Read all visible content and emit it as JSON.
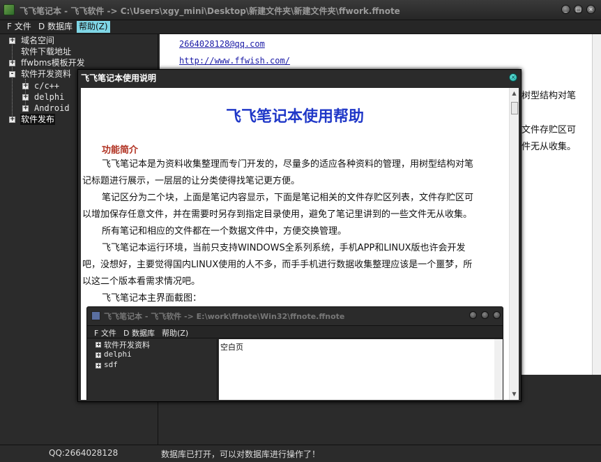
{
  "window": {
    "title": "飞飞笔记本 - 飞飞软件 -> C:\\Users\\xgy_mini\\Desktop\\新建文件夹\\新建文件夹\\ffwork.ffnote",
    "controls": [
      "_",
      "□",
      "×"
    ]
  },
  "menu": {
    "items": [
      "F 文件",
      "D 数据库",
      "帮助(Z)"
    ]
  },
  "tree": {
    "nodes": [
      {
        "label": "域名空间",
        "expander": "+"
      },
      {
        "label": "软件下载地址",
        "expander": ""
      },
      {
        "label": "ffwbms模板开发",
        "expander": "+"
      },
      {
        "label": "软件开发资料",
        "expander": "-"
      },
      {
        "label": "c/c++",
        "expander": "+"
      },
      {
        "label": "delphi",
        "expander": "+"
      },
      {
        "label": "Android",
        "expander": "+"
      },
      {
        "label": "软件发布",
        "expander": "+",
        "selected": true
      }
    ]
  },
  "background_note": {
    "email": "2664028128@qq.com",
    "url": "http://www.ffwish.com/",
    "fragments": [
      "树型结构对笔",
      "文件存贮区可",
      "件无从收集。"
    ]
  },
  "status": {
    "qq": "QQ:2664028128",
    "message": "数据库已打开，可以对数据库进行操作了！"
  },
  "dialog": {
    "title": "飞飞笔记本使用说明",
    "close_icon": "×",
    "doc": {
      "heading": "飞飞笔记本使用帮助",
      "subtitle": "功能简介",
      "paragraphs": [
        [
          "飞飞笔记本是为资料收集整理而专门开发的，尽量多的适应各种资料的管理，用树型结构对笔",
          "记标题进行展示，一层层的让分类使得找笔记更方便。"
        ],
        [
          "笔记区分为二个块，上面是笔记内容显示，下面是笔记相关的文件存贮区列表，文件存贮区可",
          "以增加保存任意文件，并在需要时另存到指定目录使用，避免了笔记里讲到的一些文件无从收集。"
        ],
        [
          "所有笔记和相应的文件都在一个数据文件中，方便交换管理。"
        ],
        [
          "飞飞笔记本运行环境，当前只支持WINDOWS全系列系统，手机APP和LINUX版也许会开发",
          "吧，没想好，主要觉得国内LINUX使用的人不多，而手手机进行数据收集整理应该是一个噩梦，所",
          "以这二个版本看需求情况吧。"
        ],
        [
          "飞飞笔记本主界面截图："
        ]
      ],
      "screenshot": {
        "title": "飞飞笔记本 - 飞飞软件 -> E:\\work\\ffnote\\Win32\\ffnote.ffnote",
        "menu": [
          "F 文件",
          "D 数据库",
          "帮助(Z)"
        ],
        "tree": [
          "软件开发资料",
          "delphi",
          "sdf"
        ],
        "content": "空白页"
      }
    }
  },
  "colors": {
    "accent_menu": "#7fd6e6",
    "heading_blue": "#2038c8",
    "subtitle_red": "#b03020",
    "link_blue": "#1a1aa6"
  }
}
